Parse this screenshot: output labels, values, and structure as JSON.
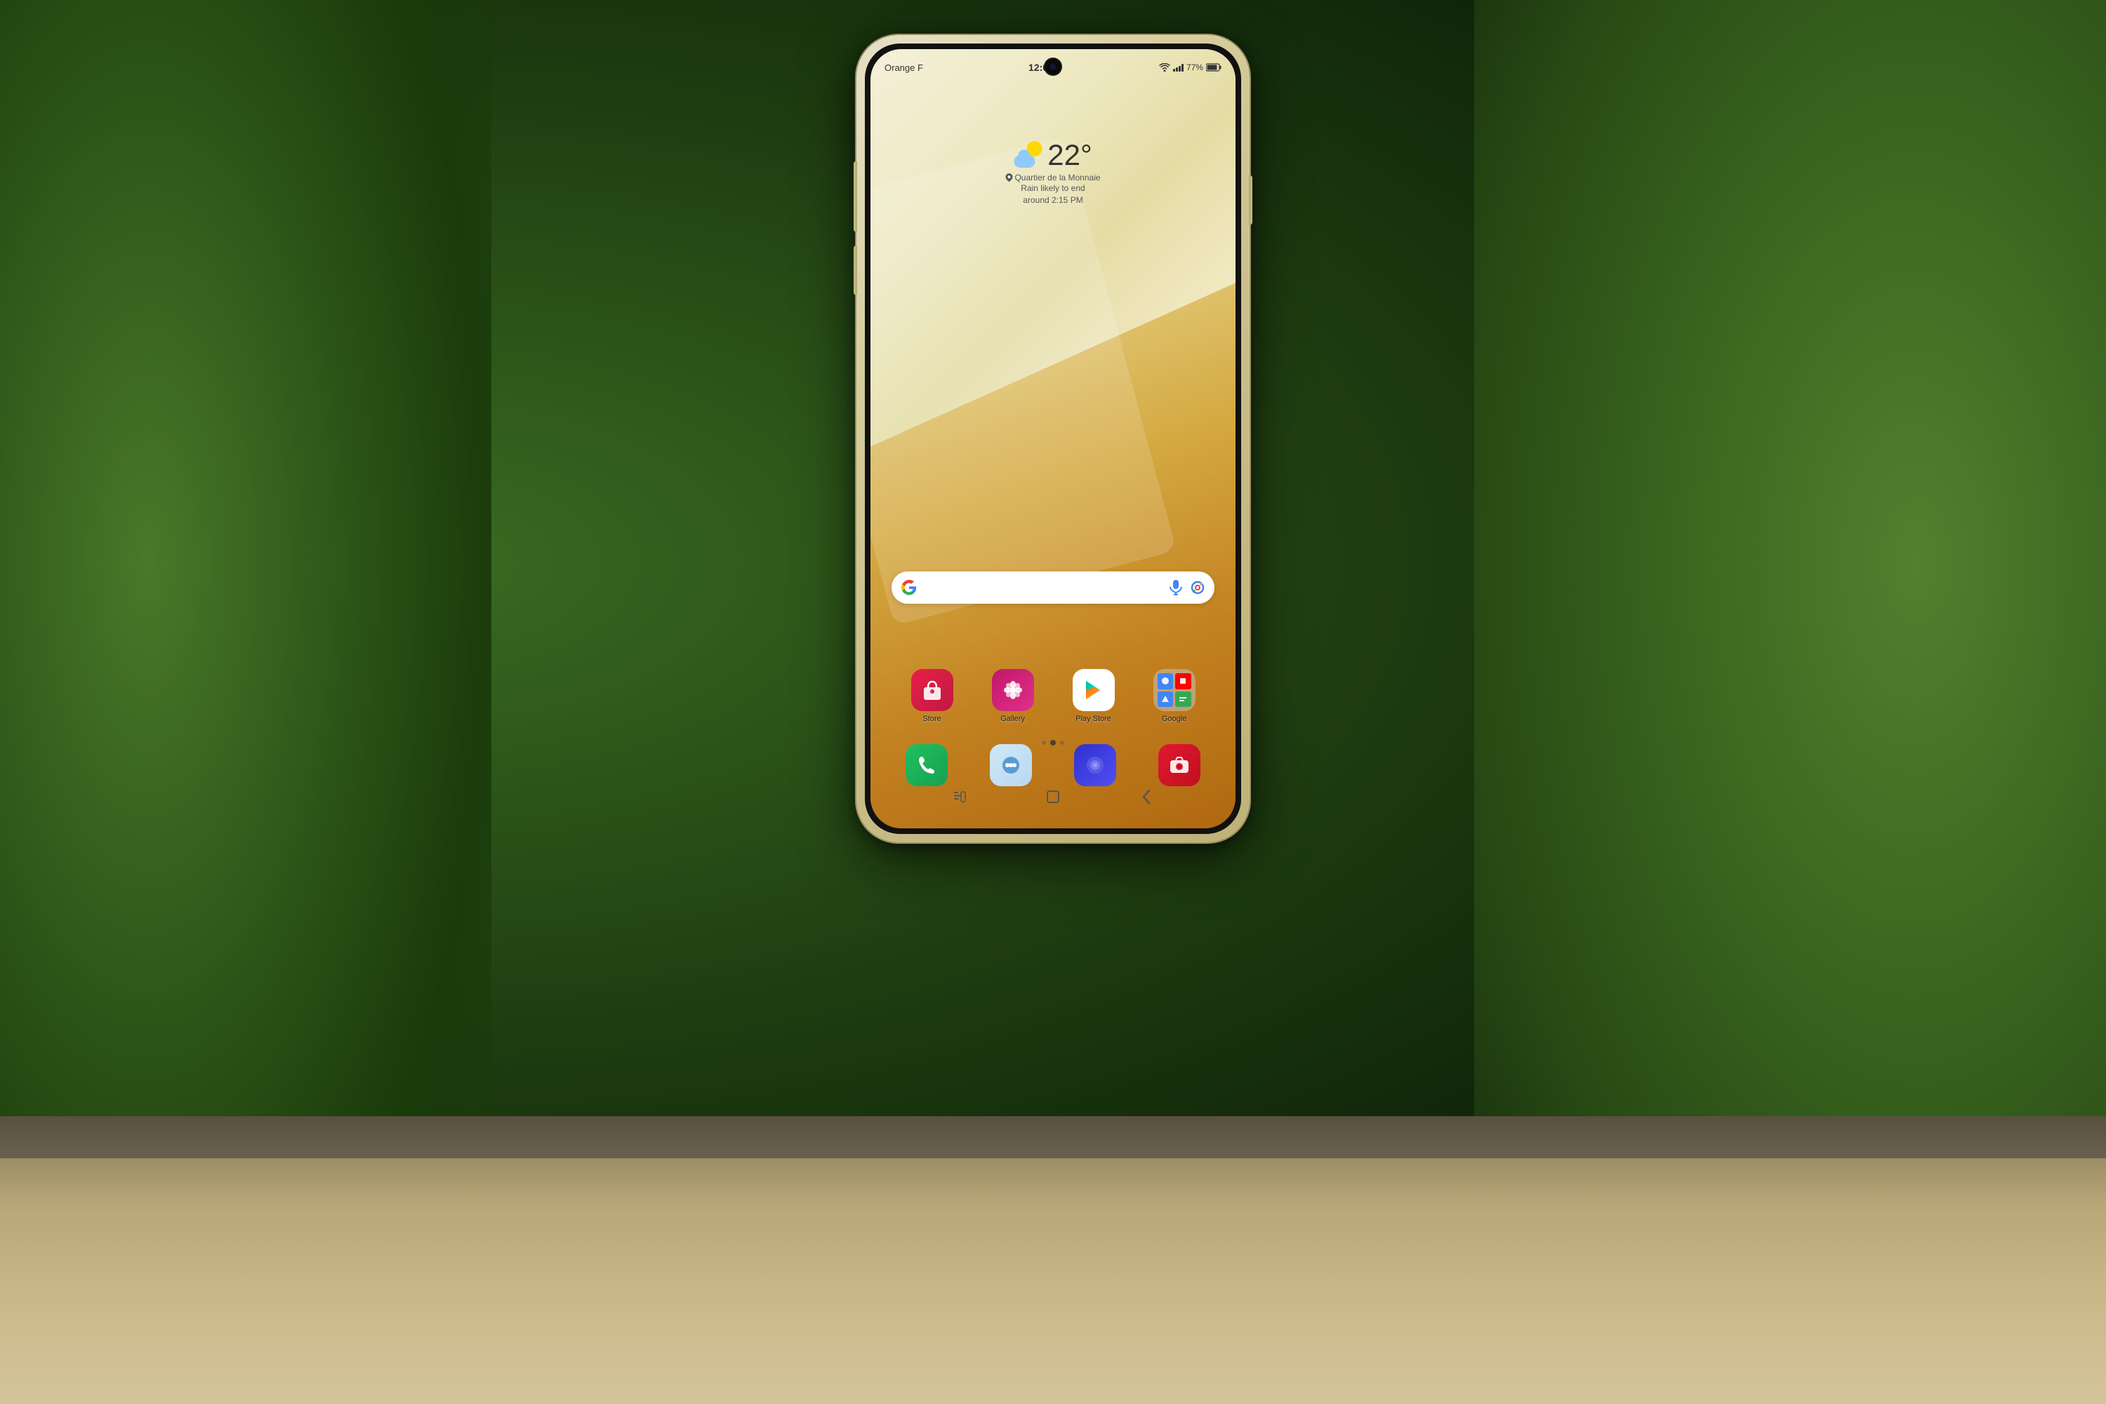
{
  "scene": {
    "bg_color": "#1a3010"
  },
  "phone": {
    "body_color": "#d4cc9a",
    "bezel_color": "#111"
  },
  "status_bar": {
    "carrier": "Orange F",
    "time": "12:05",
    "battery": "77%",
    "wifi_icon": "wifi-icon",
    "signal_icon": "signal-icon",
    "battery_icon": "battery-icon"
  },
  "weather_widget": {
    "temperature": "22°",
    "location_icon": "pin-icon",
    "location": "Quartier de la Monnaie",
    "description_line1": "Rain likely to end",
    "description_line2": "around 2:15 PM",
    "condition": "partly-cloudy"
  },
  "search_bar": {
    "placeholder": "",
    "left_icon": "google-g-icon",
    "mic_icon": "microphone-icon",
    "lens_icon": "google-lens-icon"
  },
  "app_grid": {
    "row1": [
      {
        "id": "store",
        "label": "Store",
        "icon_type": "store"
      },
      {
        "id": "gallery",
        "label": "Gallery",
        "icon_type": "gallery"
      },
      {
        "id": "play-store",
        "label": "Play Store",
        "icon_type": "playstore"
      },
      {
        "id": "google",
        "label": "Google",
        "icon_type": "google-folder"
      }
    ]
  },
  "dock": {
    "apps": [
      {
        "id": "phone",
        "label": "Phone",
        "icon_type": "phone"
      },
      {
        "id": "messages",
        "label": "Messages",
        "icon_type": "messages"
      },
      {
        "id": "browser",
        "label": "Browser",
        "icon_type": "browser"
      },
      {
        "id": "camera",
        "label": "Camera",
        "icon_type": "camera"
      }
    ]
  },
  "page_dots": {
    "count": 3,
    "active": 1
  },
  "nav_bar": {
    "back_icon": "back-icon",
    "home_icon": "home-icon",
    "recents_icon": "recents-icon"
  }
}
